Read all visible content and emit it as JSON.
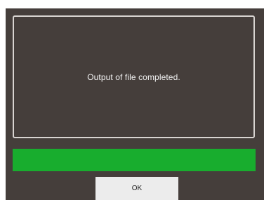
{
  "dialog": {
    "message": "Output of file completed.",
    "progress": {
      "fraction": 1.0,
      "fill_color": "#18ad2e"
    },
    "ok_label": "OK"
  },
  "colors": {
    "dialog_background": "#453e3b",
    "panel_border": "#d8d4d1",
    "button_background": "#ececec"
  }
}
